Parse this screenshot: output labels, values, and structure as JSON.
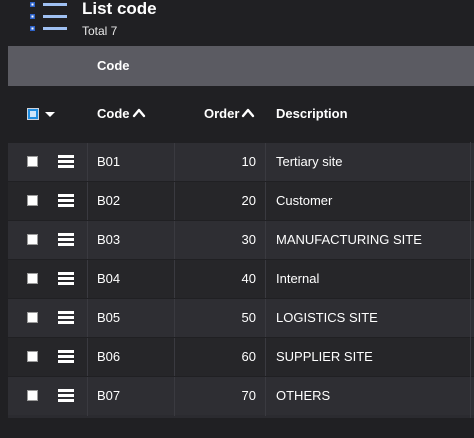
{
  "header": {
    "title": "List code",
    "subtitle": "Total 7",
    "icon": "list-icon",
    "icon_color": "#4f8fe6"
  },
  "group_bar": {
    "label": "Code"
  },
  "columns": {
    "code": "Code",
    "order": "Order",
    "description": "Description"
  },
  "rows": [
    {
      "code": "B01",
      "order": "10",
      "description": "Tertiary site"
    },
    {
      "code": "B02",
      "order": "20",
      "description": "Customer"
    },
    {
      "code": "B03",
      "order": "30",
      "description": "MANUFACTURING SITE"
    },
    {
      "code": "B04",
      "order": "40",
      "description": "Internal"
    },
    {
      "code": "B05",
      "order": "50",
      "description": "LOGISTICS SITE"
    },
    {
      "code": "B06",
      "order": "60",
      "description": "SUPPLIER SITE"
    },
    {
      "code": "B07",
      "order": "70",
      "description": "OTHERS"
    }
  ],
  "colors": {
    "background": "#202023",
    "group_bar": "#5b5b62",
    "accent": "#1f8de0"
  }
}
